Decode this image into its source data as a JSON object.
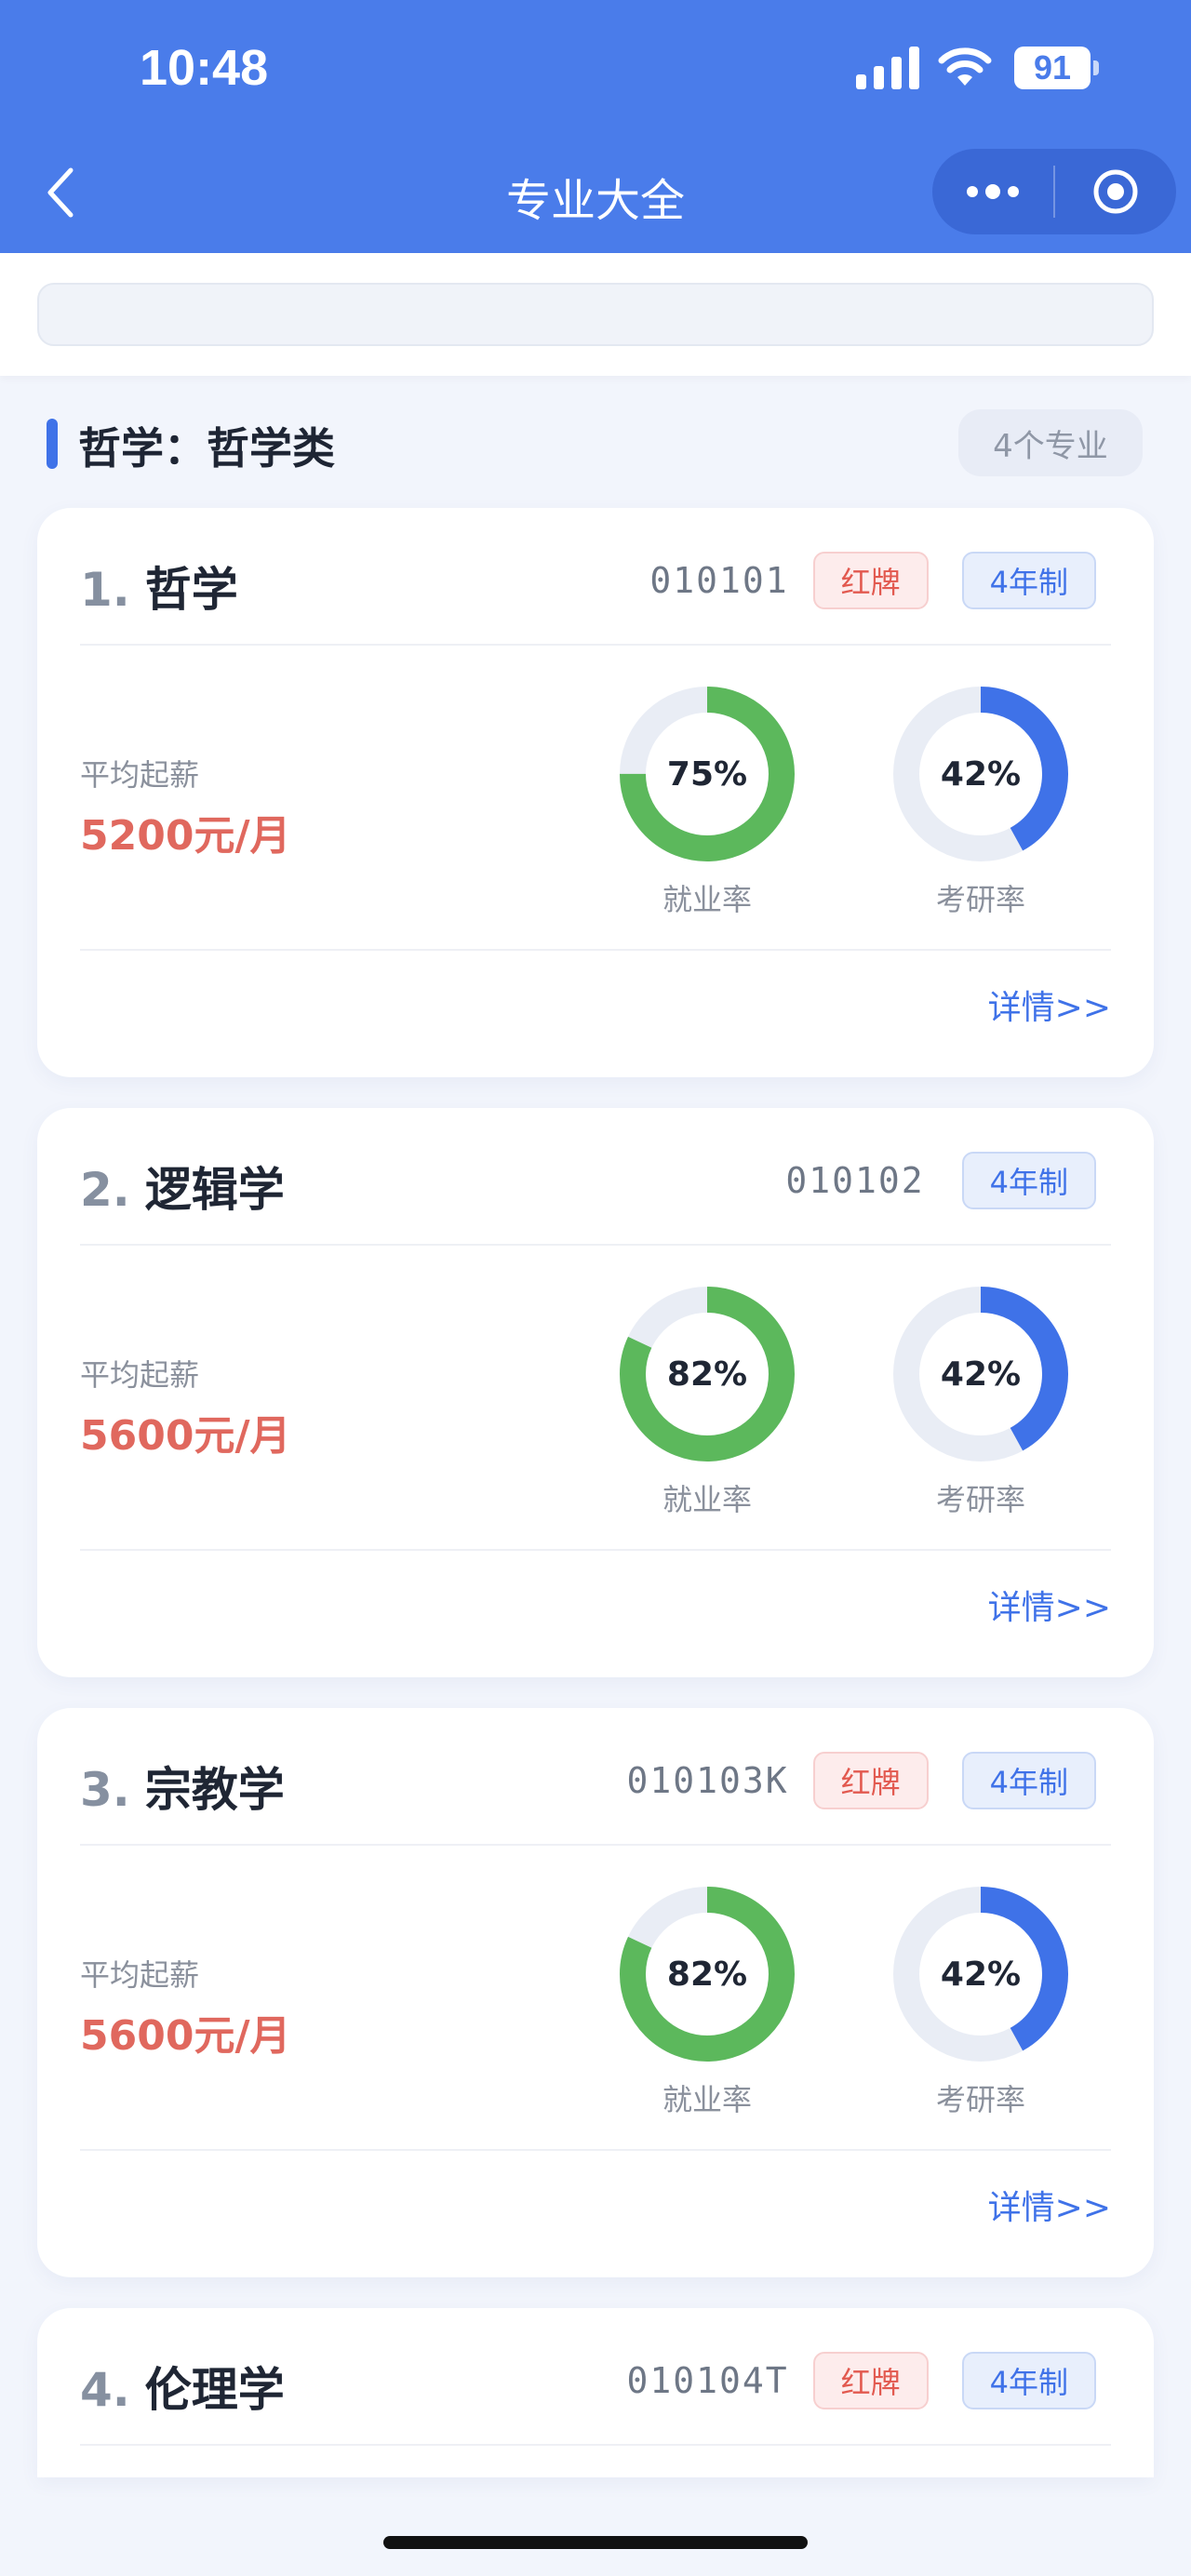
{
  "status_bar": {
    "time": "10:48",
    "battery": "91"
  },
  "nav": {
    "title": "专业大全"
  },
  "search": {
    "placeholder": ""
  },
  "section": {
    "title": "哲学：哲学类",
    "count": "4个专业"
  },
  "labels": {
    "salary": "平均起薪",
    "employment": "就业率",
    "postgrad": "考研率",
    "detail": "详情>>"
  },
  "colors": {
    "accent": "#4a7cea",
    "employment": "#5cb85c",
    "postgrad": "#3f72e8",
    "salary": "#e0685e",
    "track": "#e9edf5"
  },
  "majors": [
    {
      "index": "1.",
      "name": "哲学",
      "code": "010101",
      "red_tag": "红牌",
      "years": "4年制",
      "salary": "5200元/月",
      "employment_rate": 75,
      "employment_text": "75%",
      "postgrad_rate": 42,
      "postgrad_text": "42%"
    },
    {
      "index": "2.",
      "name": "逻辑学",
      "code": "010102",
      "red_tag": "",
      "years": "4年制",
      "salary": "5600元/月",
      "employment_rate": 82,
      "employment_text": "82%",
      "postgrad_rate": 42,
      "postgrad_text": "42%"
    },
    {
      "index": "3.",
      "name": "宗教学",
      "code": "010103K",
      "red_tag": "红牌",
      "years": "4年制",
      "salary": "5600元/月",
      "employment_rate": 82,
      "employment_text": "82%",
      "postgrad_rate": 42,
      "postgrad_text": "42%"
    },
    {
      "index": "4.",
      "name": "伦理学",
      "code": "010104T",
      "red_tag": "红牌",
      "years": "4年制"
    }
  ]
}
